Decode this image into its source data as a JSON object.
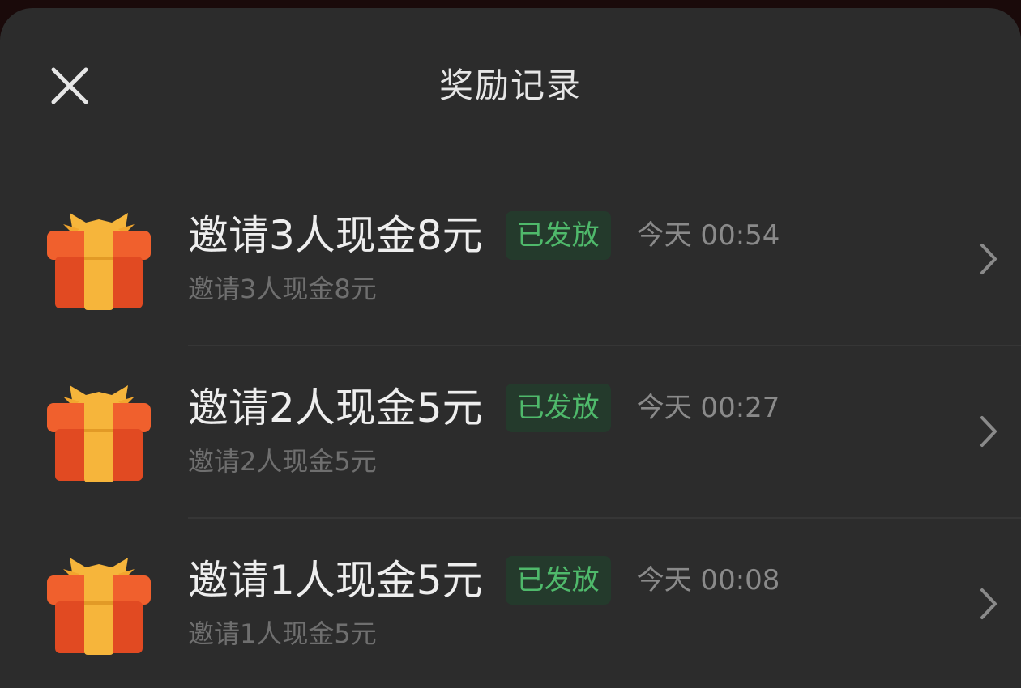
{
  "header": {
    "title": "奖励记录",
    "close_icon": "close-icon"
  },
  "colors": {
    "sheet_bg": "#2c2c2c",
    "badge_bg": "#243a2c",
    "badge_text": "#4fb96b",
    "gift_red": "#e8542a",
    "gift_ribbon": "#f6b53b"
  },
  "rewards": [
    {
      "title": "邀请3人现金8元",
      "status": "已发放",
      "time": "今天 00:54",
      "subtitle": "邀请3人现金8元",
      "icon": "gift-icon"
    },
    {
      "title": "邀请2人现金5元",
      "status": "已发放",
      "time": "今天 00:27",
      "subtitle": "邀请2人现金5元",
      "icon": "gift-icon"
    },
    {
      "title": "邀请1人现金5元",
      "status": "已发放",
      "time": "今天 00:08",
      "subtitle": "邀请1人现金5元",
      "icon": "gift-icon"
    }
  ]
}
